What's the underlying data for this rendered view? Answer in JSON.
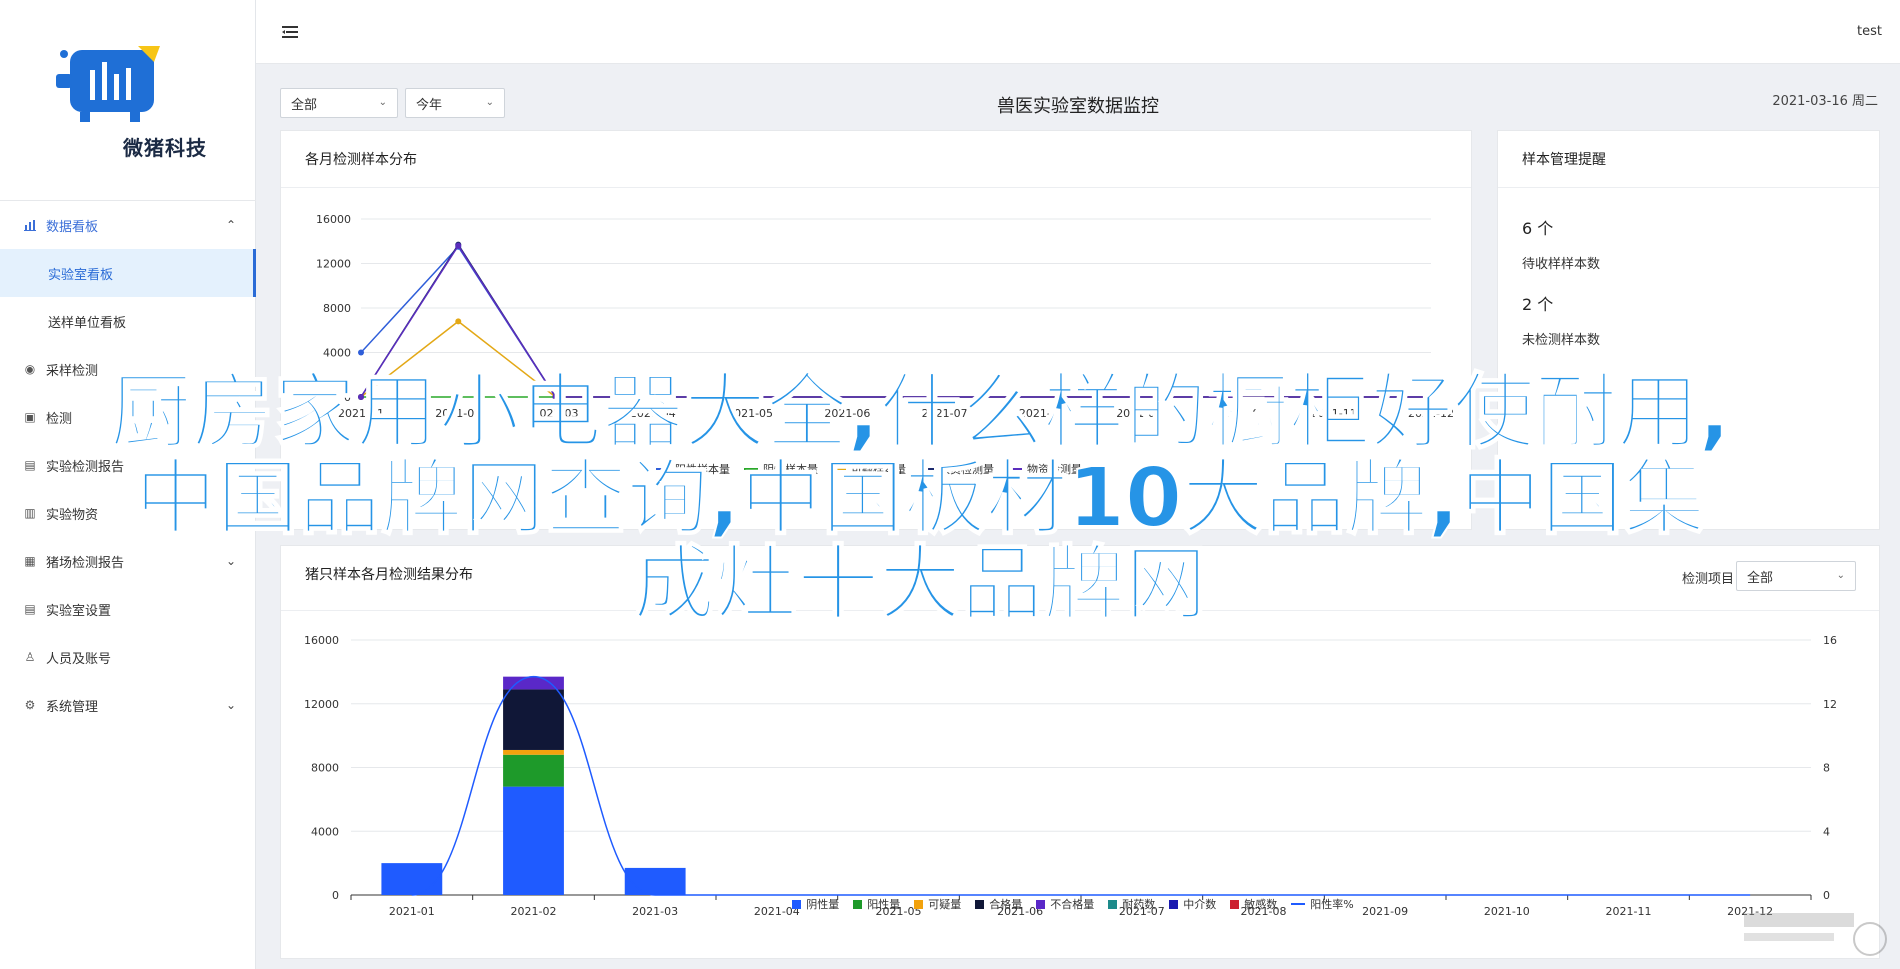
{
  "brand": {
    "name": "微猪科技"
  },
  "topbar": {
    "user": "test"
  },
  "sidebar": {
    "group": {
      "label": "数据看板",
      "icon": "bar-chart-icon"
    },
    "subitems": [
      {
        "label": "实验室看板",
        "active": true
      },
      {
        "label": "送样单位看板",
        "active": false
      }
    ],
    "items": [
      {
        "label": "采样检测",
        "icon": "eye-icon"
      },
      {
        "label": "检测",
        "icon": "lock-icon"
      },
      {
        "label": "实验检测报告",
        "icon": "document-icon"
      },
      {
        "label": "实验物资",
        "icon": "box-icon"
      },
      {
        "label": "猪场检测报告",
        "icon": "report-icon"
      },
      {
        "label": "实验室设置",
        "icon": "document-icon"
      },
      {
        "label": "人员及账号",
        "icon": "user-icon"
      },
      {
        "label": "系统管理",
        "icon": "gear-icon"
      }
    ]
  },
  "filters": {
    "region": "全部",
    "period": "今年"
  },
  "page": {
    "title": "兽医实验室数据监控",
    "date": "2021-03-16 周二"
  },
  "card1": {
    "title": "各月检测样本分布",
    "legend": [
      "阳性样本量",
      "阴性样本量",
      "可疑样本量",
      "人员检测量",
      "物资检测量"
    ]
  },
  "card2": {
    "title": "样本管理提醒",
    "stats": [
      {
        "value": "6 个",
        "label": "待收样样本数"
      },
      {
        "value": "2 个",
        "label": "未检测样本数"
      }
    ]
  },
  "card3": {
    "title": "猪只样本各月检测结果分布",
    "filter_label": "检测项目",
    "filter_value": "全部"
  },
  "overlay": {
    "lines": [
      "厨房家用小电器大全,什么样的橱柜好使耐用,",
      "中国品牌网查询,中国板材10大品牌,中国集",
      "成灶十大品牌网"
    ]
  },
  "chart_data": [
    {
      "type": "line",
      "title": "各月检测样本分布",
      "x": [
        "2021-01",
        "2021-02",
        "2021-03",
        "2021-04",
        "2021-05",
        "2021-06",
        "2021-07",
        "2021-08",
        "2021-09",
        "2021-10",
        "2021-11",
        "2021-12"
      ],
      "ylim": [
        0,
        16000
      ],
      "yticks": [
        0,
        4000,
        8000,
        12000,
        16000
      ],
      "series": [
        {
          "name": "阳性样本量",
          "color": "#2f5ed9",
          "values": [
            4000,
            13500,
            0,
            0,
            0,
            0,
            0,
            0,
            0,
            0,
            0,
            0
          ]
        },
        {
          "name": "阴性样本量",
          "color": "#29a829",
          "values": [
            0,
            0,
            0,
            0,
            0,
            0,
            0,
            0,
            0,
            0,
            0,
            0
          ]
        },
        {
          "name": "可疑样本量",
          "color": "#e3a816",
          "values": [
            0,
            6800,
            0,
            0,
            0,
            0,
            0,
            0,
            0,
            0,
            0,
            0
          ]
        },
        {
          "name": "人员检测量",
          "color": "#1c2a6e",
          "values": [
            0,
            13700,
            0,
            0,
            0,
            0,
            0,
            0,
            0,
            0,
            0,
            0
          ]
        },
        {
          "name": "物资检测量",
          "color": "#5b2dbd",
          "values": [
            0,
            13600,
            0,
            0,
            0,
            0,
            0,
            0,
            0,
            0,
            0,
            0
          ]
        }
      ],
      "grid": true,
      "legend_position": "bottom"
    },
    {
      "type": "bar",
      "title": "猪只样本各月检测结果分布",
      "categories": [
        "2021-01",
        "2021-02",
        "2021-03",
        "2021-04",
        "2021-05",
        "2021-06",
        "2021-07",
        "2021-08",
        "2021-09",
        "2021-10",
        "2021-11",
        "2021-12"
      ],
      "ylim": [
        0,
        16000
      ],
      "yticks": [
        0,
        4000,
        8000,
        12000,
        16000
      ],
      "y2lim": [
        0,
        16
      ],
      "y2ticks": [
        0,
        4,
        8,
        12,
        16
      ],
      "stacked": true,
      "series": [
        {
          "name": "阴性量",
          "color": "#1f5bff",
          "values": [
            2000,
            6800,
            1700,
            0,
            0,
            0,
            0,
            0,
            0,
            0,
            0,
            0
          ]
        },
        {
          "name": "阳性量",
          "color": "#1e9a2a",
          "values": [
            0,
            2000,
            0,
            0,
            0,
            0,
            0,
            0,
            0,
            0,
            0,
            0
          ]
        },
        {
          "name": "可疑量",
          "color": "#f2a20d",
          "values": [
            0,
            300,
            0,
            0,
            0,
            0,
            0,
            0,
            0,
            0,
            0,
            0
          ]
        },
        {
          "name": "合格量",
          "color": "#101737",
          "values": [
            0,
            3800,
            0,
            0,
            0,
            0,
            0,
            0,
            0,
            0,
            0,
            0
          ]
        },
        {
          "name": "不合格量",
          "color": "#5a28c8",
          "values": [
            0,
            800,
            0,
            0,
            0,
            0,
            0,
            0,
            0,
            0,
            0,
            0
          ]
        },
        {
          "name": "耐药数",
          "color": "#1d8a8a",
          "values": [
            0,
            0,
            0,
            0,
            0,
            0,
            0,
            0,
            0,
            0,
            0,
            0
          ]
        },
        {
          "name": "中介数",
          "color": "#1a1ab0",
          "values": [
            0,
            0,
            0,
            0,
            0,
            0,
            0,
            0,
            0,
            0,
            0,
            0
          ]
        },
        {
          "name": "敏感数",
          "color": "#cc1f2f",
          "values": [
            0,
            0,
            0,
            0,
            0,
            0,
            0,
            0,
            0,
            0,
            0,
            0
          ]
        }
      ],
      "line_series": {
        "name": "阳性率%",
        "color": "#1f5bff",
        "axis": "right",
        "values": [
          0,
          13.7,
          0,
          0,
          0,
          0,
          0,
          0,
          0,
          0,
          0,
          0
        ]
      },
      "grid": true,
      "legend_position": "bottom"
    }
  ]
}
